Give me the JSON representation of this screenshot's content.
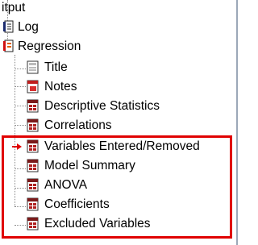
{
  "tree": {
    "root_label": "itput",
    "items": [
      {
        "label": "Log",
        "icon": "log-icon"
      },
      {
        "label": "Regression",
        "icon": "regression-icon"
      },
      {
        "label": "Title",
        "icon": "title-icon"
      },
      {
        "label": "Notes",
        "icon": "notes-icon"
      },
      {
        "label": "Descriptive Statistics",
        "icon": "table-icon"
      },
      {
        "label": "Correlations",
        "icon": "table-icon"
      },
      {
        "label": "Variables Entered/Removed",
        "icon": "table-icon"
      },
      {
        "label": "Model Summary",
        "icon": "table-icon"
      },
      {
        "label": "ANOVA",
        "icon": "table-icon"
      },
      {
        "label": "Coefficients",
        "icon": "table-icon"
      },
      {
        "label": "Excluded Variables",
        "icon": "table-icon"
      }
    ],
    "current_marker_icon": "red-arrow-icon",
    "highlight_color": "#e00000"
  }
}
